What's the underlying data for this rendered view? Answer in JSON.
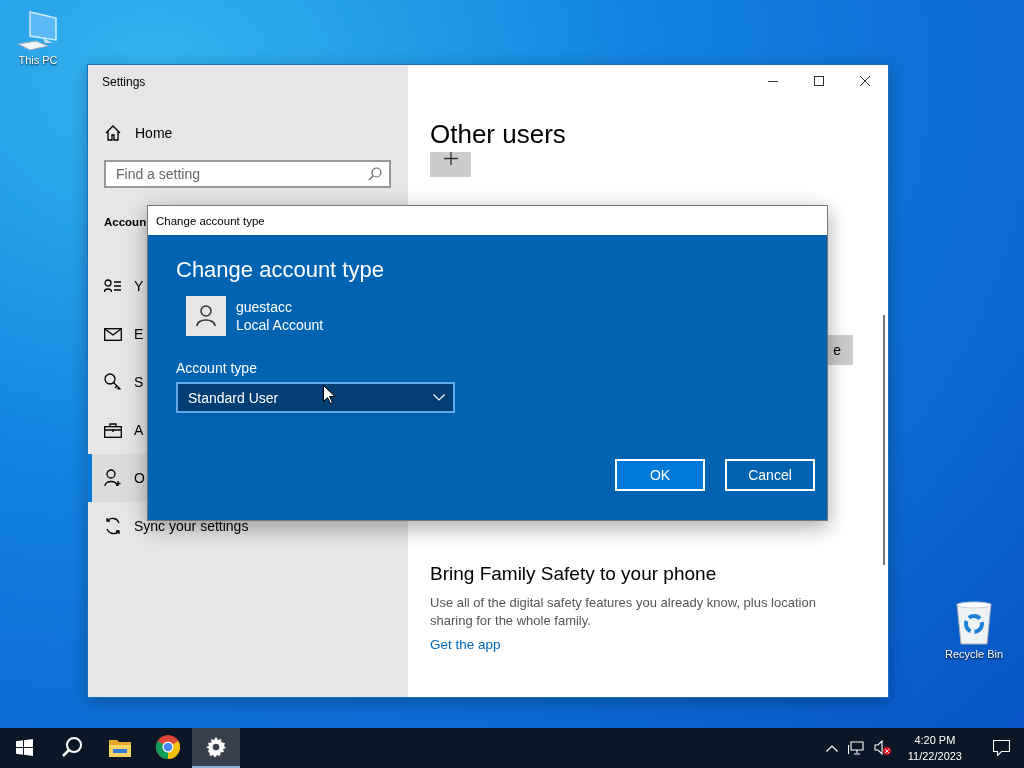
{
  "desktop_icons": [
    {
      "label": "This PC",
      "kind": "computer"
    },
    {
      "label": "Recycle Bin",
      "kind": "bin"
    }
  ],
  "settings_window": {
    "title": "Settings",
    "home": "Home",
    "search": {
      "placeholder": "Find a setting"
    },
    "section": "Accoun",
    "nav": [
      {
        "label": "Y",
        "kind": "info",
        "selected": false
      },
      {
        "label": "E",
        "kind": "mail",
        "selected": false
      },
      {
        "label": "S",
        "kind": "key",
        "selected": false
      },
      {
        "label": "A",
        "kind": "briefcase",
        "selected": false
      },
      {
        "label": "O",
        "kind": "people",
        "selected": true
      },
      {
        "label": "Sync your settings",
        "kind": "sync",
        "selected": false
      }
    ],
    "heading": "Other users",
    "side_button": "e",
    "family": {
      "title": "Bring Family Safety to your phone",
      "text": "Use all of the digital safety features you already know, plus location sharing for the whole family.",
      "link": "Get the app"
    }
  },
  "dialog": {
    "title": "Change account type",
    "heading": "Change account type",
    "user": {
      "name": "guestacc",
      "type": "Local Account"
    },
    "field_label": "Account type",
    "value": "Standard User",
    "buttons": [
      {
        "label": "OK",
        "default": true
      },
      {
        "label": "Cancel",
        "default": false
      }
    ]
  },
  "taskbar": {
    "apps": [
      {
        "kind": "start",
        "active": false
      },
      {
        "kind": "search",
        "active": false
      },
      {
        "kind": "explorer",
        "active": false
      },
      {
        "kind": "browser",
        "active": false
      },
      {
        "kind": "settings",
        "active": true
      }
    ],
    "time": "4:20 PM",
    "date": "11/22/2023"
  }
}
